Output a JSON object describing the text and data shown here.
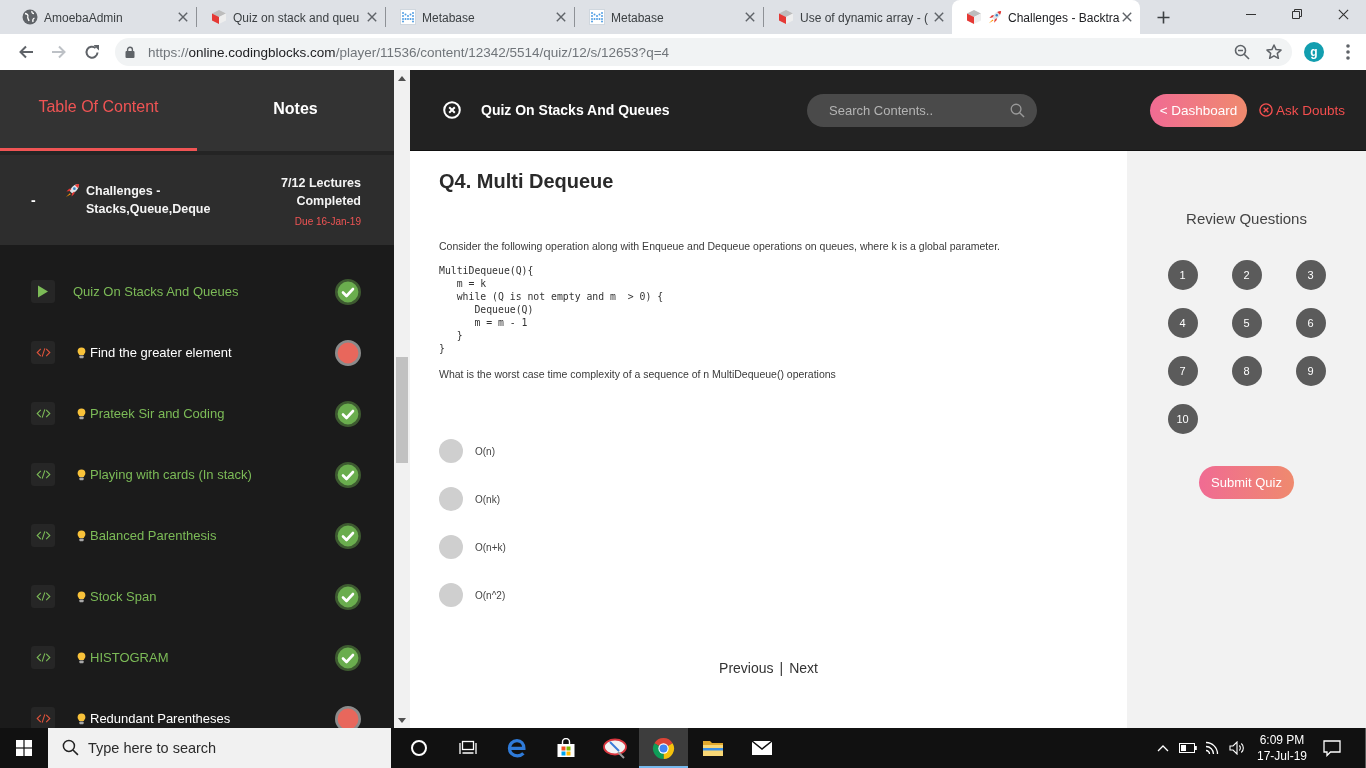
{
  "browser": {
    "tabs": [
      {
        "title": "AmoebaAdmin",
        "kind": "globe",
        "selected": false
      },
      {
        "title": "Quiz on stack and queu",
        "kind": "cube",
        "selected": false
      },
      {
        "title": "Metabase",
        "kind": "metabase",
        "selected": false
      },
      {
        "title": "Metabase",
        "kind": "metabase",
        "selected": false
      },
      {
        "title": "Use of dynamic array - (",
        "kind": "cube",
        "selected": false
      },
      {
        "title": "Challenges - Backtra",
        "kind": "challenge",
        "selected": true
      }
    ],
    "address": {
      "scheme": "https://",
      "host": "online.codingblocks.com",
      "path": "/player/11536/content/12342/5514/quiz/12/s/12653?q=4"
    },
    "profile_initial": "g"
  },
  "sidebar": {
    "tabs": [
      {
        "label": "Table Of Content",
        "selected": true
      },
      {
        "label": "Notes",
        "selected": false
      }
    ],
    "section": {
      "toggle": "-",
      "title": "Challenges - Stacks,Queue,Deque",
      "lectures": "7/12 Lectures Completed",
      "due": "Due 16-Jan-19"
    },
    "items": [
      {
        "title": "Quiz On Stacks And Queues",
        "kind": "quiz",
        "done": true
      },
      {
        "title": "Find the greater element",
        "kind": "code",
        "done": false
      },
      {
        "title": "Prateek Sir and Coding",
        "kind": "code",
        "done": true
      },
      {
        "title": "Playing with cards (In stack)",
        "kind": "code",
        "done": true
      },
      {
        "title": "Balanced Parenthesis",
        "kind": "code",
        "done": true
      },
      {
        "title": "Stock Span",
        "kind": "code",
        "done": true
      },
      {
        "title": "HISTOGRAM",
        "kind": "code",
        "done": true
      },
      {
        "title": "Redundant Parentheses",
        "kind": "code",
        "done": false
      }
    ]
  },
  "header": {
    "title": "Quiz On Stacks And Queues",
    "search_placeholder": "Search Contents..",
    "dashboard_button": "< Dashboard",
    "ask_doubts": "Ask Doubts"
  },
  "question": {
    "title": "Q4. Multi Dequeue",
    "intro": "Consider the following operation along with Enqueue and Dequeue operations on queues, where k is a global parameter.",
    "code": "MultiDequeue(Q){\n   m = k\n   while (Q is not empty and m  > 0) {\n      Dequeue(Q)\n      m = m - 1\n   }\n}",
    "prompt": "What is the worst case time complexity of a sequence of n MultiDequeue() operations",
    "options": [
      {
        "label": "O(n)",
        "selected": false
      },
      {
        "label": "O(nk)",
        "selected": false
      },
      {
        "label": "O(n+k)",
        "selected": false
      },
      {
        "label": "O(n^2)",
        "selected": false
      }
    ]
  },
  "pager": {
    "previous": "Previous",
    "separator": "|",
    "next": "Next"
  },
  "review": {
    "title": "Review Questions",
    "questions": [
      "1",
      "2",
      "3",
      "4",
      "5",
      "6",
      "7",
      "8",
      "9",
      "10"
    ],
    "submit": "Submit Quiz"
  },
  "taskbar": {
    "search_placeholder": "Type here to search",
    "apps": [
      {
        "kind": "cortana",
        "active": false
      },
      {
        "kind": "task-view",
        "active": false
      },
      {
        "kind": "edge",
        "active": false
      },
      {
        "kind": "store",
        "active": false
      },
      {
        "kind": "drawing",
        "active": false
      },
      {
        "kind": "chrome",
        "active": true
      },
      {
        "kind": "explorer",
        "active": false
      },
      {
        "kind": "mail",
        "active": false
      }
    ],
    "time": "6:09 PM",
    "date": "17-Jul-19"
  }
}
